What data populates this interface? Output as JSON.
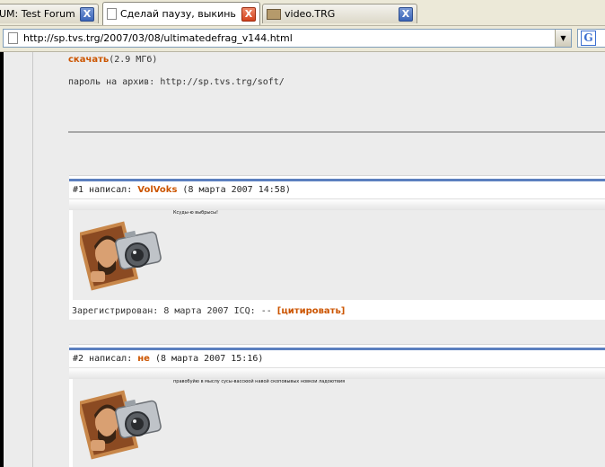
{
  "tabs": [
    {
      "title": "UM: Test Forum...",
      "close": "X",
      "active": false
    },
    {
      "title": "Сделай паузу, выкинь ...",
      "close": "X",
      "active": true
    },
    {
      "title": "video.TRG",
      "close": "X",
      "active": false
    }
  ],
  "address": {
    "url": "http://sp.tvs.trg/2007/03/08/ultimatedefrag_v144.html",
    "dropdown": "▼"
  },
  "search": {
    "engine_letter": "G"
  },
  "article": {
    "download_link": "скачать",
    "download_size": "(2.9 МГб)",
    "password_text": "пароль на архив: http://sp.tvs.trg/soft/"
  },
  "posts": [
    {
      "prefix": "#1 написал: ",
      "author": "VolVoks",
      "date": " (8 марта 2007 14:58)",
      "body_text": "Ксуды-ю выбрысы!",
      "footer": "Зарегистрирован: 8 марта 2007 ICQ: -- ",
      "quote": "[цитировать]"
    },
    {
      "prefix": "#2 написал: ",
      "author": "не",
      "date": " (8 марта 2007 15:16)",
      "body_text": "правобуйю в мыслу сусы-вассюой навой скоповывых новкои ладоютвия",
      "footer": "",
      "quote": ""
    }
  ],
  "colors": {
    "accent": "#cc5500",
    "post_rule": "#5b7fbf"
  },
  "icons": {
    "tab_close": "close-icon",
    "page": "page-icon",
    "search_engine": "google-icon"
  }
}
